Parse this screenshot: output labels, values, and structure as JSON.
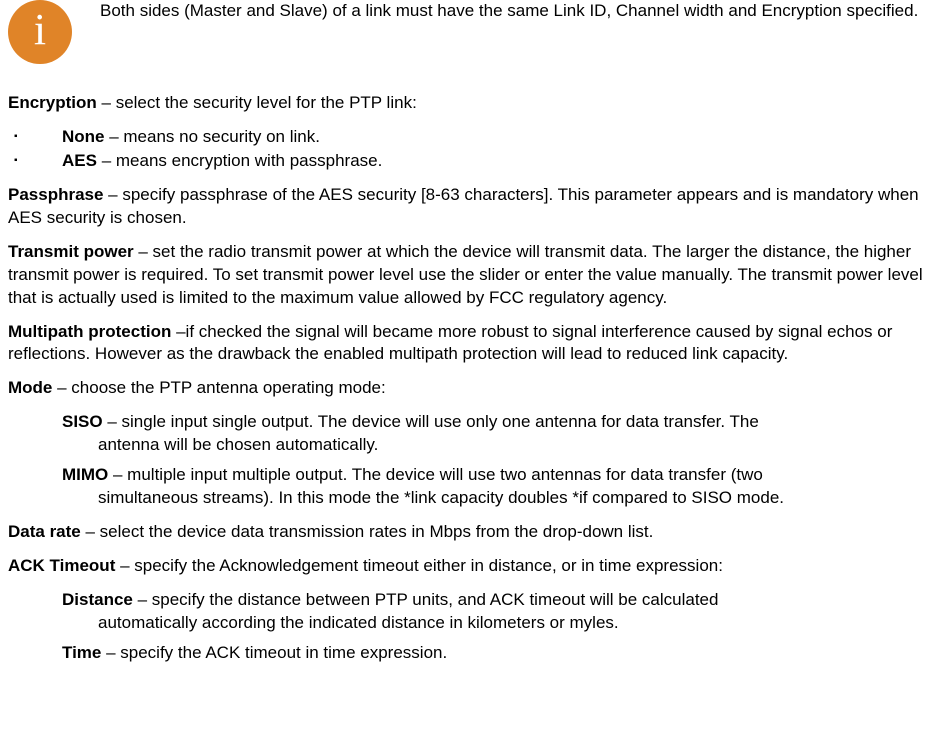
{
  "info": {
    "icon_char": "i",
    "text": "Both sides (Master and Slave) of a link must have the same Link ID, Channel width and Encryption specified."
  },
  "encryption": {
    "label": "Encryption",
    "desc": " – select the security level for the PTP link:",
    "options": {
      "none_label": "None",
      "none_desc": " – means no security on link.",
      "aes_label": "AES",
      "aes_desc": " – means encryption with passphrase."
    }
  },
  "passphrase": {
    "label": "Passphrase",
    "desc": " – specify passphrase of the AES security [8-63 characters]. This parameter appears and is mandatory when AES security is chosen."
  },
  "transmit_power": {
    "label": "Transmit power",
    "desc": " – set the radio transmit power at which the device will transmit data. The larger the distance, the higher transmit power is required. To set transmit power level use the slider or enter the value manually. The transmit power level that is actually used is limited to the maximum value allowed by FCC regulatory agency."
  },
  "multipath": {
    "label": "Multipath protection",
    "desc": " –if checked the signal will became more robust to signal interference caused by signal echos or reflections. However as the drawback the enabled multipath protection will lead to reduced link capacity."
  },
  "mode": {
    "label": "Mode",
    "desc": " – choose the PTP antenna operating mode:",
    "siso_label": "SISO",
    "siso_lead": " – single input single output. The device will use only one antenna for data transfer. The ",
    "siso_rest": "antenna will be chosen automatically.",
    "mimo_label": "MIMO",
    "mimo_lead": " – multiple input multiple output. The device will use two antennas for data transfer (two ",
    "mimo_rest": "simultaneous streams). In this mode the *link capacity doubles *if compared to SISO mode."
  },
  "data_rate": {
    "label": "Data rate",
    "desc": " – select the device data transmission rates in Mbps from the drop-down list."
  },
  "ack": {
    "label": "ACK Timeout",
    "desc": " – specify the Acknowledgement timeout either in distance, or in time expression:",
    "distance_label": "Distance",
    "distance_lead": " – specify the distance between PTP units, and ACK timeout will be calculated ",
    "distance_rest": "automatically according the indicated distance in kilometers or myles.",
    "time_label": "Time",
    "time_desc": " – specify the ACK timeout in time expression."
  }
}
